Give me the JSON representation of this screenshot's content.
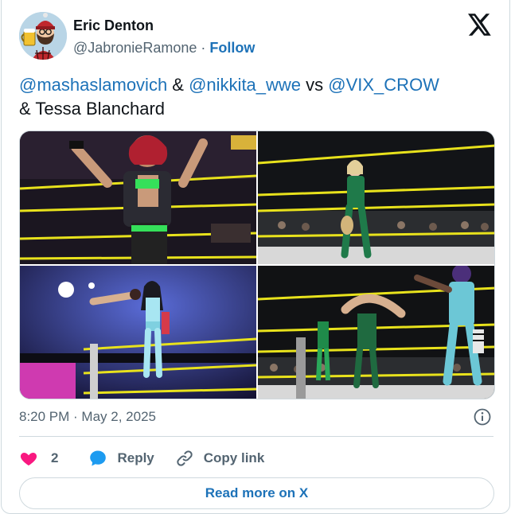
{
  "author": {
    "name": "Eric Denton",
    "handle": "@JabronieRamone",
    "separator": "·",
    "follow_label": "Follow"
  },
  "tweet": {
    "mention_1": "@mashaslamovich",
    "amp_1": " & ",
    "mention_2": "@nikkita_wwe",
    "vs": " vs ",
    "mention_3": "@VIX_CROW",
    "tail": "& Tessa Blanchard"
  },
  "media": {
    "photo_count": 4,
    "ring_rope_color": "#e8e21c"
  },
  "meta": {
    "timestamp": "8:20 PM · May 2, 2025"
  },
  "actions": {
    "like_count": "2",
    "reply_label": "Reply",
    "copy_link_label": "Copy link"
  },
  "footer": {
    "read_more_label": "Read more on X"
  },
  "colors": {
    "link": "#1d72b8",
    "like": "#f91880",
    "muted": "#536471",
    "border": "#cfd9de"
  },
  "icons": [
    "x-logo-icon",
    "info-icon",
    "heart-icon",
    "reply-icon",
    "link-icon"
  ]
}
